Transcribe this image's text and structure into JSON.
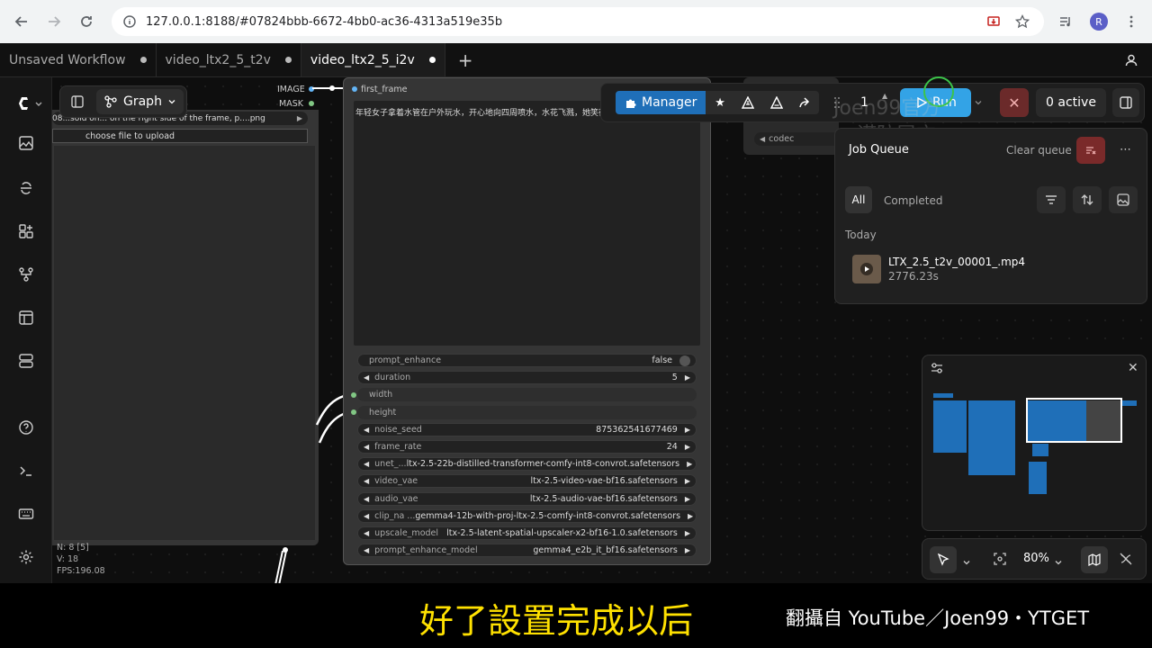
{
  "browser": {
    "url": "127.0.0.1:8188/#07824bbb-6672-4bb0-ac36-4313a519e35b",
    "profile_initial": "R"
  },
  "tabs": [
    {
      "label": "Unsaved Workflow"
    },
    {
      "label": "video_ltx2_5_t2v"
    },
    {
      "label": "video_ltx2_5_i2v"
    }
  ],
  "graph": {
    "label": "Graph"
  },
  "left_node": {
    "file": "08...sold on... on the right side of the frame, p....png",
    "upload": "choose file to upload",
    "outputs": [
      "IMAGE",
      "MASK"
    ],
    "stats": [
      "N: 8 [5]",
      "V: 18",
      "FPS:196.08"
    ]
  },
  "mid_node": {
    "input": "first_frame",
    "prompt": "年轻女子拿着水管在户外玩水，开心地向四周喷水，水花飞溅，她笑得很开心，写实电影风格。",
    "widgets": [
      {
        "label": "prompt_enhance",
        "value": "false",
        "type": "toggle"
      },
      {
        "label": "duration",
        "value": "5",
        "type": "num"
      },
      {
        "label": "width",
        "value": "",
        "type": "dim"
      },
      {
        "label": "height",
        "value": "",
        "type": "dim"
      },
      {
        "label": "noise_seed",
        "value": "875362541677469",
        "type": "num"
      },
      {
        "label": "frame_rate",
        "value": "24",
        "type": "num"
      },
      {
        "label": "unet_...",
        "value": "ltx-2.5-22b-distilled-transformer-comfy-int8-convrot.safetensors",
        "type": "combo"
      },
      {
        "label": "video_vae",
        "value": "ltx-2.5-video-vae-bf16.safetensors",
        "type": "combo"
      },
      {
        "label": "audio_vae",
        "value": "ltx-2.5-audio-vae-bf16.safetensors",
        "type": "combo"
      },
      {
        "label": "clip_na ...",
        "value": "gemma4-12b-with-proj-ltx-2.5-comfy-int8-convrot.safetensors",
        "type": "combo"
      },
      {
        "label": "upscale_model",
        "value": "ltx-2.5-latent-spatial-upscaler-x2-bf16-1.0.safetensors",
        "type": "combo"
      },
      {
        "label": "prompt_enhance_model",
        "value": "gemma4_e2b_it_bf16.safetensors",
        "type": "combo"
      }
    ]
  },
  "toolbar": {
    "manager": "Manager",
    "quantity": "1",
    "run": "Run",
    "active": "0 active"
  },
  "watermark": [
    "Joen99官方",
    "谨防冒充"
  ],
  "side_node": {
    "codec": "codec"
  },
  "job_queue": {
    "title": "Job Queue",
    "clear": "Clear queue",
    "filters": [
      "All",
      "Completed"
    ],
    "group": "Today",
    "jobs": [
      {
        "name": "LTX_2.5_t2v_00001_.mp4",
        "time": "2776.23s"
      }
    ]
  },
  "zoom": {
    "value": "80%"
  },
  "subtitle": "好了設置完成以后",
  "credit": "翻攝自 YouTube／Joen99・YTGET",
  "colors": {
    "accent": "#33a3e6",
    "manager": "#1f6fb8",
    "stop": "#6b2a2a",
    "subtitle": "#ffe100"
  }
}
